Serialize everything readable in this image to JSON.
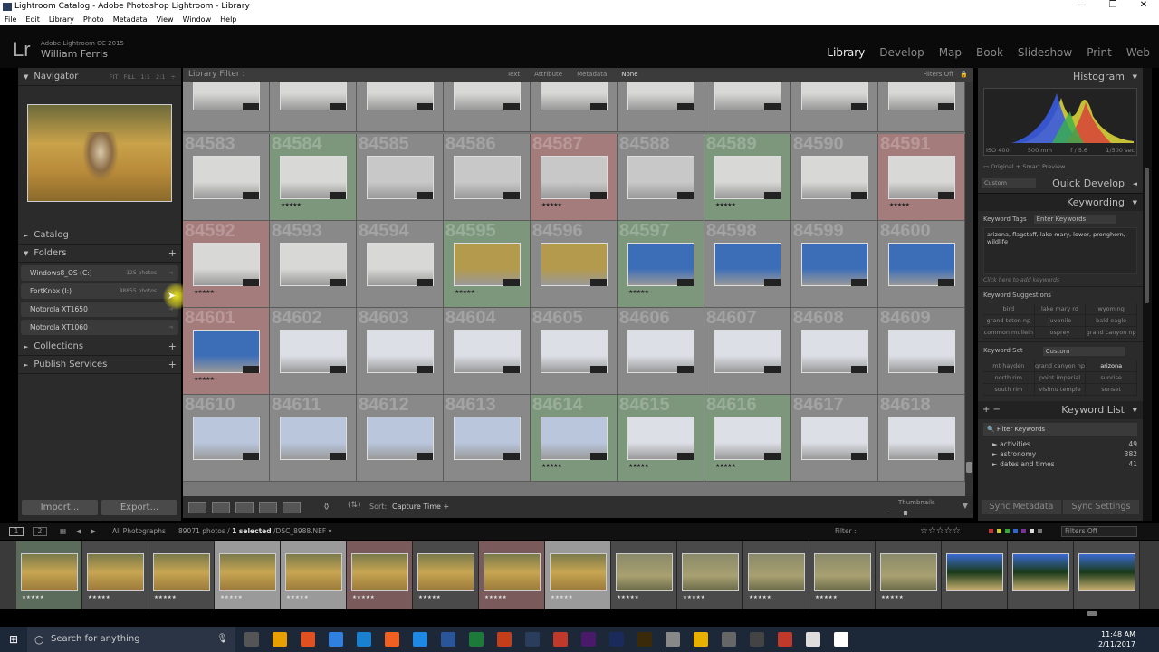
{
  "window": {
    "title": "Lightroom Catalog - Adobe Photoshop Lightroom - Library",
    "controls": [
      "—",
      "❐",
      "✕"
    ]
  },
  "menu": [
    "File",
    "Edit",
    "Library",
    "Photo",
    "Metadata",
    "View",
    "Window",
    "Help"
  ],
  "identity": {
    "logo": "Lr",
    "product": "Adobe Lightroom CC 2015",
    "user": "William Ferris"
  },
  "modules": [
    "Library",
    "Develop",
    "Map",
    "Book",
    "Slideshow",
    "Print",
    "Web"
  ],
  "active_module": "Library",
  "left": {
    "navigator": {
      "title": "Navigator",
      "zoom_options": [
        "FIT",
        "FILL",
        "1:1",
        "2:1 ÷"
      ]
    },
    "catalog": "Catalog",
    "folders": {
      "title": "Folders",
      "items": [
        {
          "name": "Windows8_OS (C:)",
          "count": "125 photos"
        },
        {
          "name": "FortKnox (I:)",
          "count": "88855 photos"
        },
        {
          "name": "Motorola XT1650",
          "count": ""
        },
        {
          "name": "Motorola XT1060",
          "count": ""
        }
      ]
    },
    "collections": "Collections",
    "publish": "Publish Services",
    "import": "Import...",
    "export": "Export..."
  },
  "filter": {
    "label": "Library Filter :",
    "options": [
      "Text",
      "Attribute",
      "Metadata",
      "None"
    ],
    "active": "None",
    "status": "Filters Off"
  },
  "grid": {
    "rows": [
      {
        "nums": [
          "",
          "",
          "",
          "",
          "",
          "",
          "",
          "",
          ""
        ],
        "labels": [
          "",
          "",
          "",
          "",
          "",
          "",
          "",
          "",
          ""
        ]
      },
      {
        "nums": [
          "84583",
          "84584",
          "84585",
          "84586",
          "84587",
          "84588",
          "84589",
          "84590",
          "84591"
        ],
        "labels": [
          "",
          "green",
          "",
          "",
          "red",
          "",
          "green",
          "",
          "red"
        ]
      },
      {
        "nums": [
          "84592",
          "84593",
          "84594",
          "84595",
          "84596",
          "84597",
          "84598",
          "84599",
          "84600"
        ],
        "labels": [
          "red",
          "",
          "",
          "green",
          "",
          "green",
          "",
          "",
          ""
        ]
      },
      {
        "nums": [
          "84601",
          "84602",
          "84603",
          "84604",
          "84605",
          "84606",
          "84607",
          "84608",
          "84609"
        ],
        "labels": [
          "red",
          "",
          "",
          "",
          "",
          "",
          "",
          "",
          ""
        ]
      },
      {
        "nums": [
          "84610",
          "84611",
          "84612",
          "84613",
          "84614",
          "84615",
          "84616",
          "84617",
          "84618"
        ],
        "labels": [
          "",
          "",
          "",
          "",
          "green",
          "green",
          "green",
          "",
          ""
        ]
      }
    ],
    "thumb_colors": {
      "lake": "#d8d8d6",
      "grass": "#b49a4c",
      "sky": "#3c6eb8",
      "overcast": "#dcdfe6"
    }
  },
  "toolbar": {
    "sort_label": "Sort:",
    "sort_value": "Capture Time ÷",
    "thumbnails_label": "Thumbnails"
  },
  "right": {
    "histogram": {
      "title": "Histogram",
      "iso": "ISO 400",
      "focal": "500 mm",
      "aperture": "f / 5.6",
      "shutter": "1/500 sec",
      "preview": "Original + Smart Preview"
    },
    "quick_develop": {
      "title": "Quick Develop",
      "preset": "Custom"
    },
    "keywording": {
      "title": "Keywording",
      "tags_label": "Keyword Tags",
      "tags_mode": "Enter Keywords",
      "keywords": "arizona, flagstaff, lake mary, lower, pronghorn, wildlife",
      "add_hint": "Click here to add keywords",
      "suggestions_title": "Keyword Suggestions",
      "suggestions": [
        "bird",
        "lake mary rd",
        "wyoming",
        "grand teton np",
        "juvenile",
        "bald eagle",
        "common mullein",
        "osprey",
        "grand canyon np"
      ],
      "set_label": "Keyword Set",
      "set_value": "Custom",
      "set": [
        "mt hayden",
        "grand canyon np",
        "arizona",
        "north rim",
        "point imperial",
        "sunrise",
        "south rim",
        "vishnu temple",
        "sunset"
      ]
    },
    "keyword_list": {
      "title": "Keyword List",
      "filter_placeholder": "Filter Keywords",
      "items": [
        {
          "name": "activities",
          "count": "49"
        },
        {
          "name": "astronomy",
          "count": "382"
        },
        {
          "name": "dates and times",
          "count": "41"
        }
      ]
    },
    "sync_metadata": "Sync Metadata",
    "sync_settings": "Sync Settings"
  },
  "filmstrip": {
    "screens": [
      "1",
      "2"
    ],
    "source": "All Photographs",
    "count": "89071 photos /",
    "selected": "1 selected",
    "file": "/DSC_8988.NEF ▾",
    "filter_label": "Filter :",
    "filter_status": "Filters Off",
    "stars": "☆☆☆☆☆",
    "frames": [
      "green",
      "",
      "",
      "sel",
      "sel",
      "red",
      "",
      "red",
      "sel",
      "",
      "",
      "",
      "",
      "",
      "",
      "",
      ""
    ]
  },
  "taskbar": {
    "search": "Search for anything",
    "time": "11:48 AM",
    "date": "2/11/2017"
  }
}
